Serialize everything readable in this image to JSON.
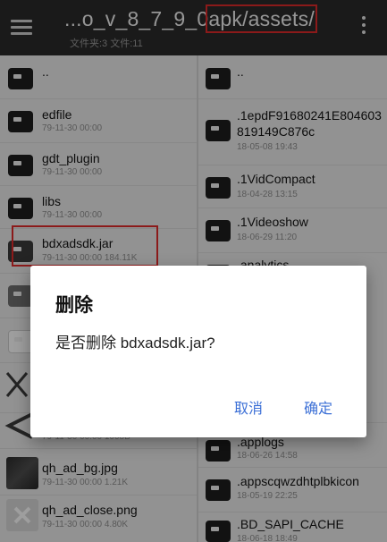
{
  "toolbar": {
    "path_prefix": "...o_v_8_7_9_0",
    "path_highlight": "apk/assets/",
    "subtitle": "文件夹:3 文件:11",
    "menu_icon": "hamburger-icon",
    "more_icon": "more-vert-icon"
  },
  "left_pane": {
    "items": [
      {
        "name": "..",
        "meta": "",
        "icon": "folder-icon"
      },
      {
        "name": "edfile",
        "meta": "79-11-30 00:00",
        "icon": "folder-icon"
      },
      {
        "name": "gdt_plugin",
        "meta": "79-11-30 00:00",
        "icon": "folder-icon"
      },
      {
        "name": "libs",
        "meta": "79-11-30 00:00",
        "icon": "folder-icon"
      },
      {
        "name": "bdxadsdk.jar",
        "meta": "79-11-30 00:00 184.11K",
        "icon": "archive-icon"
      },
      {
        "name": "",
        "meta": "",
        "icon": "image-icon"
      },
      {
        "name": "",
        "meta": "",
        "icon": "file-icon"
      },
      {
        "name": "",
        "meta": "",
        "icon": "close-image-icon"
      },
      {
        "name": "",
        "meta": "79-11-30 00:00 1008B",
        "icon": "back-image-icon"
      },
      {
        "name": "qh_ad_bg.jpg",
        "meta": "79-11-30 00:00 1.21K",
        "icon": "image-thumb"
      },
      {
        "name": "qh_ad_close.png",
        "meta": "79-11-30 00:00 4.80K",
        "icon": "close-thumb"
      }
    ]
  },
  "right_pane": {
    "items": [
      {
        "name": "..",
        "meta": "",
        "icon": "folder-icon"
      },
      {
        "name": ".1epdF91680241E804603819149C876c",
        "meta": "18-05-08 19:43",
        "icon": "folder-icon"
      },
      {
        "name": ".1VidCompact",
        "meta": "18-04-28 13:15",
        "icon": "folder-icon"
      },
      {
        "name": ".1Videoshow",
        "meta": "18-06-29 11:20",
        "icon": "folder-icon"
      },
      {
        "name": ".analytics",
        "meta": "",
        "icon": "folder-icon"
      },
      {
        "name": ".applogs",
        "meta": "18-06-26 14:58",
        "icon": "folder-icon"
      },
      {
        "name": ".appscqwzdhtplbkicon",
        "meta": "18-05-19 22:25",
        "icon": "folder-icon"
      },
      {
        "name": ".BD_SAPI_CACHE",
        "meta": "18-06-18 18:49",
        "icon": "folder-icon"
      }
    ]
  },
  "dialog": {
    "title": "删除",
    "message": "是否删除 bdxadsdk.jar?",
    "cancel_label": "取消",
    "confirm_label": "确定"
  },
  "colors": {
    "toolbar_bg": "#2a2a2a",
    "highlight_red": "#e02a2a",
    "dialog_button": "#3b6fd6"
  }
}
